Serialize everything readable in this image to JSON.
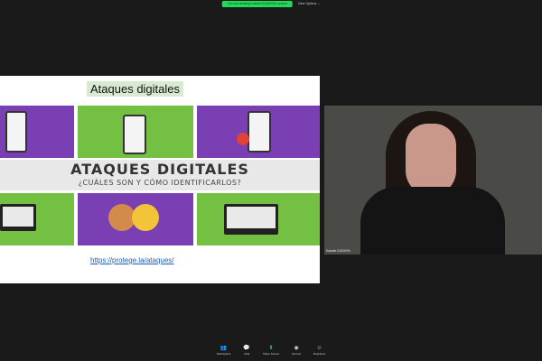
{
  "top_bar": {
    "sharing_label": "You are viewing Kassiel DUSAYN's screen",
    "view_options": "View Options ⌄"
  },
  "slide": {
    "title": "Ataques digitales",
    "banner_title": "ATAQUES DIGITALES",
    "banner_subtitle": "¿CUÁLES SON Y CÓMO IDENTIFICARLOS?",
    "link": "https://protege.la/ataques/",
    "colors": {
      "green": "#74c043",
      "purple": "#7a3fb3"
    }
  },
  "video": {
    "name": "Kassiel DUSAYN"
  },
  "toolbar": {
    "items": [
      {
        "label": "Participants",
        "icon": "participants-icon"
      },
      {
        "label": "Chat",
        "icon": "chat-icon"
      },
      {
        "label": "Share Screen",
        "icon": "share-screen-icon"
      },
      {
        "label": "Record",
        "icon": "record-icon"
      },
      {
        "label": "Reactions",
        "icon": "reactions-icon"
      }
    ],
    "participants_count": "30"
  }
}
